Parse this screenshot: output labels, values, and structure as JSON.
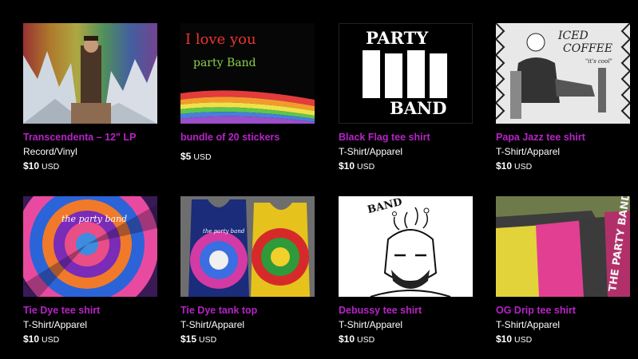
{
  "items": [
    {
      "title": "Transcendenta – 12\" LP",
      "type": "Record/Vinyl",
      "price": "$10",
      "currency": "USD",
      "art": "collage-icon"
    },
    {
      "title": "bundle of 20 stickers",
      "type": "",
      "price": "$5",
      "currency": "USD",
      "art": "sticker-icon",
      "art_text": {
        "line1": "I love you",
        "line2": "party Band"
      }
    },
    {
      "title": "Black Flag tee shirt",
      "type": "T-Shirt/Apparel",
      "price": "$10",
      "currency": "USD",
      "art": "flag-logo-icon",
      "art_text": {
        "top": "PARTY",
        "bottom": "BAND"
      }
    },
    {
      "title": "Papa Jazz tee shirt",
      "type": "T-Shirt/Apparel",
      "price": "$10",
      "currency": "USD",
      "art": "sketch-icon",
      "art_text": {
        "line1": "ICED",
        "line2": "COFFEE",
        "tag": "\"it's cool\""
      }
    },
    {
      "title": "Tie Dye tee shirt",
      "type": "T-Shirt/Apparel",
      "price": "$10",
      "currency": "USD",
      "art": "tie-dye-icon",
      "art_text": {
        "script": "the party band"
      }
    },
    {
      "title": "Tie Dye tank top",
      "type": "T-Shirt/Apparel",
      "price": "$15",
      "currency": "USD",
      "art": "tank-top-icon",
      "art_text": {
        "script": "the party band"
      }
    },
    {
      "title": "Debussy tee shirt",
      "type": "T-Shirt/Apparel",
      "price": "$10",
      "currency": "USD",
      "art": "portrait-icon",
      "art_text": {
        "top": "BAND"
      }
    },
    {
      "title": "OG Drip tee shirt",
      "type": "T-Shirt/Apparel",
      "price": "$10",
      "currency": "USD",
      "art": "shirts-pile-icon",
      "art_text": {
        "script": "THE PARTY BAND"
      }
    }
  ],
  "colors": {
    "title": "#b623c6",
    "background": "#000000",
    "text": "#ffffff"
  }
}
